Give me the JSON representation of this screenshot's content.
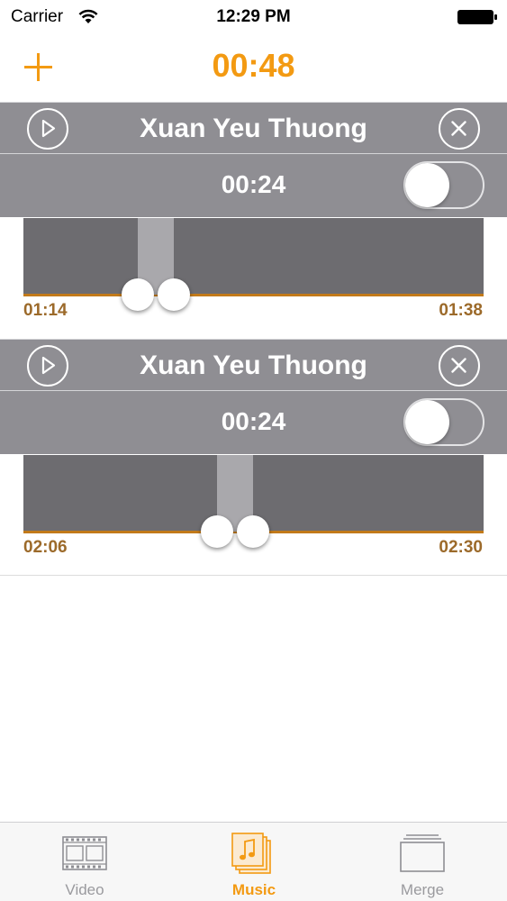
{
  "status": {
    "carrier": "Carrier",
    "time": "12:29 PM"
  },
  "nav": {
    "total_duration": "00:48"
  },
  "tracks": [
    {
      "title": "Xuan Yeu Thuong",
      "duration": "00:24",
      "start_time": "01:14",
      "end_time": "01:38",
      "toggle_on": false
    },
    {
      "title": "Xuan Yeu Thuong",
      "duration": "00:24",
      "start_time": "02:06",
      "end_time": "02:30",
      "toggle_on": false
    }
  ],
  "tabs": [
    {
      "label": "Video",
      "icon": "film-icon",
      "active": false
    },
    {
      "label": "Music",
      "icon": "music-note-icon",
      "active": true
    },
    {
      "label": "Merge",
      "icon": "layers-icon",
      "active": false
    }
  ],
  "colors": {
    "accent": "#f39a12",
    "track_bar": "#8f8e93",
    "waveform": "#6d6c70",
    "time_label": "#9c6a2a"
  }
}
